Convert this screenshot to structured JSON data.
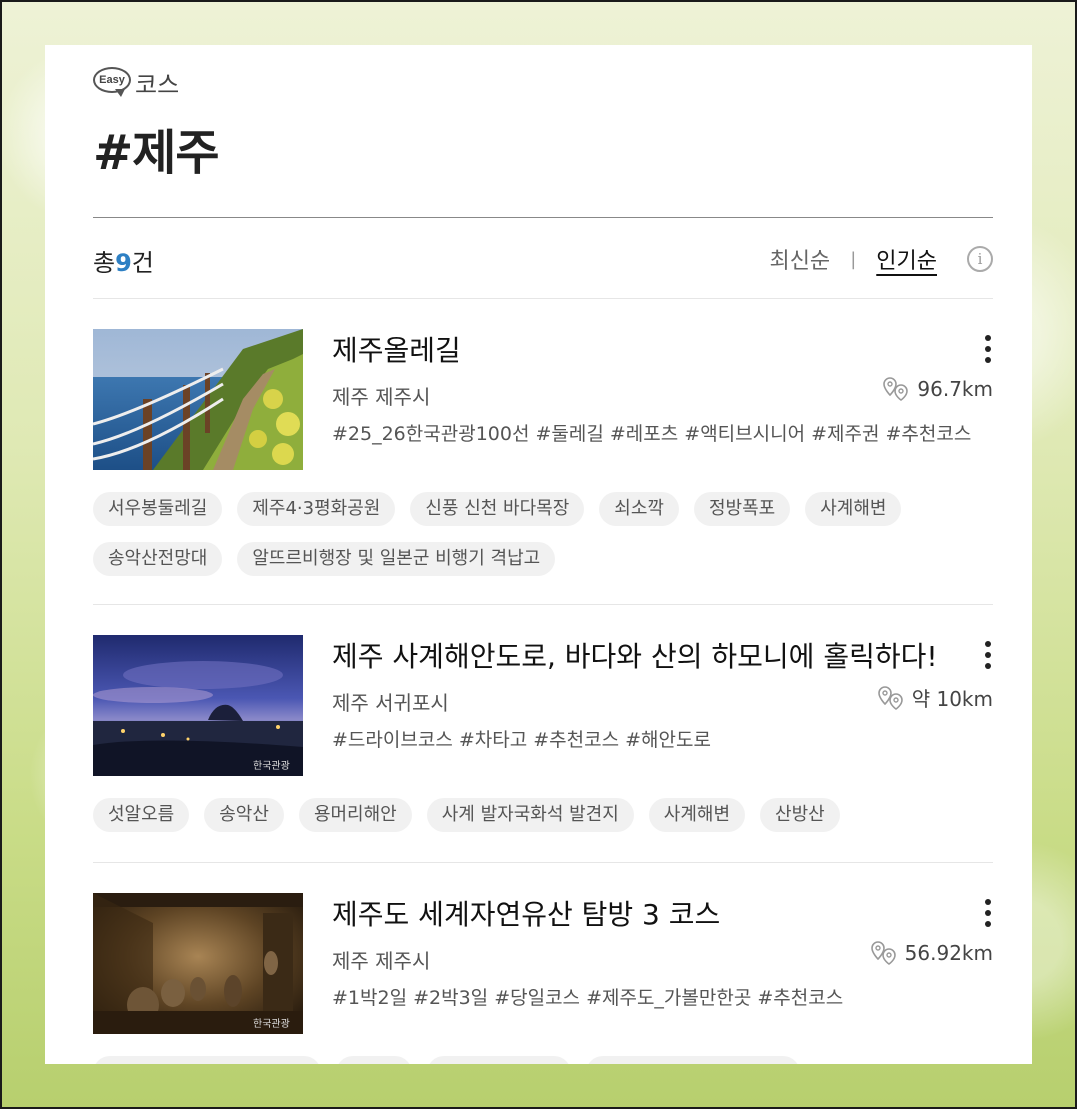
{
  "header": {
    "easy_badge": "Easy",
    "section_label": "코스",
    "title": "#제주"
  },
  "summary": {
    "prefix": "총",
    "count": "9",
    "suffix": "건"
  },
  "sort": {
    "options": [
      "최신순",
      "인기순"
    ],
    "separator": "|",
    "active": "인기순",
    "info_icon": "info-icon"
  },
  "courses": [
    {
      "title": "제주올레길",
      "region": "제주 제주시",
      "distance": "96.7km",
      "hashtags": "#25_26한국관광100선 #둘레길 #레포츠 #액티브시니어 #제주권 #추천코스",
      "image": "coastal-trail-photo",
      "spots": [
        "서우봉둘레길",
        "제주4·3평화공원",
        "신풍 신천 바다목장",
        "쇠소깍",
        "정방폭포",
        "사계해변",
        "송악산전망대",
        "알뜨르비행장 및 일본군 비행기 격납고"
      ]
    },
    {
      "title": "제주 사계해안도로, 바다와 산의 하모니에 홀릭하다!",
      "region": "제주 서귀포시",
      "distance": "약 10km",
      "hashtags": "#드라이브코스 #차타고 #추천코스 #해안도로",
      "image": "dusk-coast-photo",
      "spots": [
        "섯알오름",
        "송악산",
        "용머리해안",
        "사계 발자국화석 발견지",
        "사계해변",
        "산방산"
      ]
    },
    {
      "title": "제주도 세계자연유산 탐방 3 코스",
      "region": "제주 제주시",
      "distance": "56.92km",
      "hashtags": "#1박2일 #2박3일 #당일코스 #제주도_가볼만한곳 #추천코스",
      "image": "museum-exhibit-photo",
      "spots": [
        "",
        "",
        "",
        ""
      ]
    }
  ],
  "colors": {
    "accent": "#2e80c4",
    "chip_bg": "#f1f1f1"
  }
}
